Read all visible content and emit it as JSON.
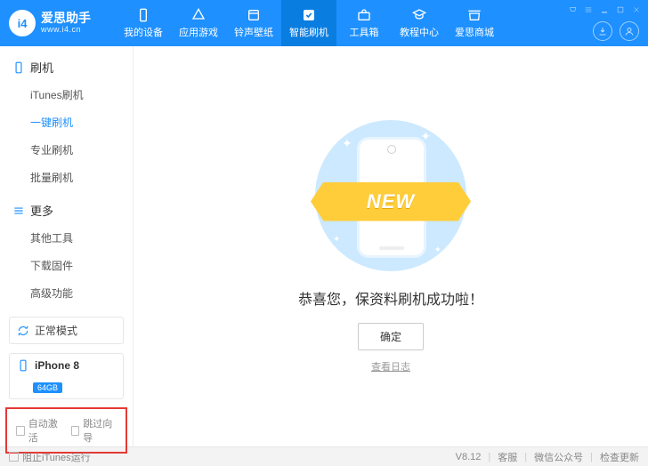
{
  "brand": {
    "name": "爱思助手",
    "url": "www.i4.cn",
    "logo_text": "i4"
  },
  "nav": [
    {
      "label": "我的设备"
    },
    {
      "label": "应用游戏"
    },
    {
      "label": "铃声壁纸"
    },
    {
      "label": "智能刷机",
      "active": true
    },
    {
      "label": "工具箱"
    },
    {
      "label": "教程中心"
    },
    {
      "label": "爱思商城"
    }
  ],
  "sidebar": {
    "section1": {
      "title": "刷机",
      "items": [
        "iTunes刷机",
        "一键刷机",
        "专业刷机",
        "批量刷机"
      ],
      "active_index": 1
    },
    "section2": {
      "title": "更多",
      "items": [
        "其他工具",
        "下载固件",
        "高级功能"
      ]
    }
  },
  "mode": {
    "label": "正常模式"
  },
  "device": {
    "name": "iPhone 8",
    "storage": "64GB"
  },
  "checkboxes": {
    "auto_activate": "自动激活",
    "skip_setup": "跳过向导"
  },
  "main": {
    "ribbon": "NEW",
    "success": "恭喜您，保资料刷机成功啦！",
    "confirm": "确定",
    "view_log": "查看日志"
  },
  "footer": {
    "block_itunes": "阻止iTunes运行",
    "version": "V8.12",
    "links": [
      "客服",
      "微信公众号",
      "检查更新"
    ]
  }
}
